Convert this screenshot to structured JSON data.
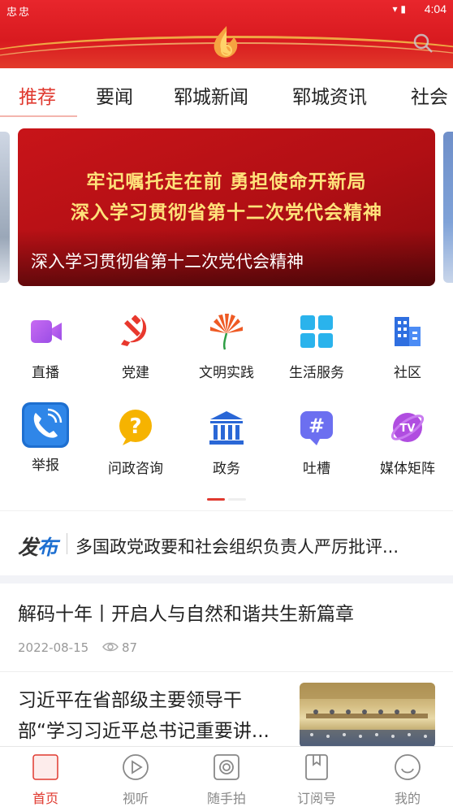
{
  "status_bar": {
    "left_icons": "忠忠",
    "time": "4:04"
  },
  "header": {
    "accent": "#e0392f"
  },
  "tabs": [
    {
      "label": "推荐"
    },
    {
      "label": "要闻"
    },
    {
      "label": "郓城新闻"
    },
    {
      "label": "郓城资讯"
    },
    {
      "label": "社会"
    }
  ],
  "banner": {
    "line1": "牢记嘱托走在前 勇担使命开新局",
    "line2": "深入学习贯彻省第十二次党代会精神",
    "caption": "深入学习贯彻省第十二次党代会精神"
  },
  "grid": [
    {
      "label": "直播",
      "icon": "video-icon"
    },
    {
      "label": "党建",
      "icon": "party-emblem-icon"
    },
    {
      "label": "文明实践",
      "icon": "civilization-icon"
    },
    {
      "label": "生活服务",
      "icon": "grid-icon"
    },
    {
      "label": "社区",
      "icon": "building-icon"
    },
    {
      "label": "举报",
      "icon": "phone-icon"
    },
    {
      "label": "问政咨询",
      "icon": "question-icon"
    },
    {
      "label": "政务",
      "icon": "government-icon"
    },
    {
      "label": "吐槽",
      "icon": "hashtag-icon"
    },
    {
      "label": "媒体矩阵",
      "icon": "tv-icon"
    }
  ],
  "ticker": {
    "brand_a": "发",
    "brand_b": "布",
    "text": "多国政党政要和社会组织负责人严厉批评..."
  },
  "articles": [
    {
      "title": "解码十年丨开启人与自然和谐共生新篇章",
      "date": "2022-08-15",
      "views": "87"
    },
    {
      "title_line1": "习近平在省部级主要领导干",
      "title_line2": "部“学习习近平总书记重要讲..."
    }
  ],
  "bottom_nav": [
    {
      "label": "首页"
    },
    {
      "label": "视听"
    },
    {
      "label": "随手拍"
    },
    {
      "label": "订阅号"
    },
    {
      "label": "我的"
    }
  ]
}
